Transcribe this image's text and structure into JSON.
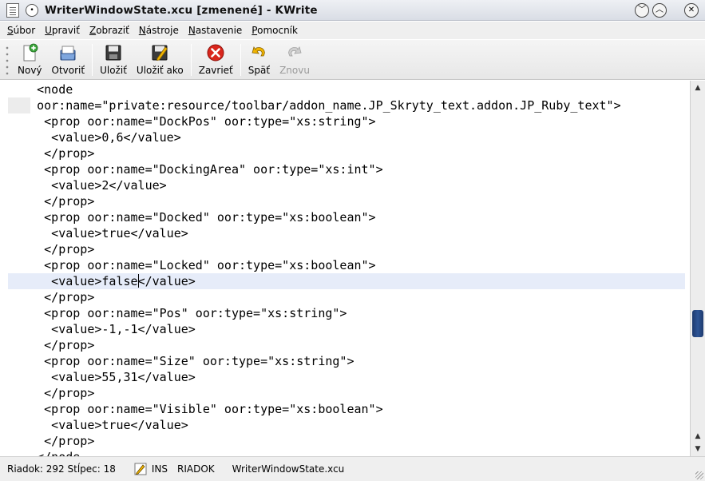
{
  "window": {
    "title": "WriterWindowState.xcu [zmenené] - KWrite",
    "buttons": {
      "minimize": "﹀",
      "maximize": "︿",
      "close": "✕"
    }
  },
  "menubar": {
    "items": [
      "Súbor",
      "Upraviť",
      "Zobraziť",
      "Nástroje",
      "Nastavenie",
      "Pomocník"
    ]
  },
  "toolbar": {
    "new": "Nový",
    "open": "Otvoriť",
    "save": "Uložiť",
    "save_as": "Uložiť ako",
    "close": "Zavrieť",
    "undo": "Späť",
    "redo": "Znovu"
  },
  "editor": {
    "lines": [
      "    <node",
      "    oor:name=\"private:resource/toolbar/addon_name.JP_Skryty_text.addon.JP_Ruby_text\">",
      "     <prop oor:name=\"DockPos\" oor:type=\"xs:string\">",
      "      <value>0,6</value>",
      "     </prop>",
      "     <prop oor:name=\"DockingArea\" oor:type=\"xs:int\">",
      "      <value>2</value>",
      "     </prop>",
      "     <prop oor:name=\"Docked\" oor:type=\"xs:boolean\">",
      "      <value>true</value>",
      "     </prop>",
      "     <prop oor:name=\"Locked\" oor:type=\"xs:boolean\">",
      "      <value>false</value>",
      "     </prop>",
      "     <prop oor:name=\"Pos\" oor:type=\"xs:string\">",
      "      <value>-1,-1</value>",
      "     </prop>",
      "     <prop oor:name=\"Size\" oor:type=\"xs:string\">",
      "      <value>55,31</value>",
      "     </prop>",
      "     <prop oor:name=\"Visible\" oor:type=\"xs:boolean\">",
      "      <value>true</value>",
      "     </prop>",
      "    </node"
    ],
    "current_line_before_caret": "      <value>false",
    "current_line_after_caret": "</value>"
  },
  "statusbar": {
    "position": "Riadok: 292 Stĺpec: 18",
    "mode": "INS",
    "selection_mode": "RIADOK",
    "filename": "WriterWindowState.xcu"
  },
  "colors": {
    "current_line": "#e6ecf9",
    "scrollbar_thumb": "#2e5596",
    "close_icon_red": "#d9261c",
    "new_icon_green": "#3aa53a"
  }
}
